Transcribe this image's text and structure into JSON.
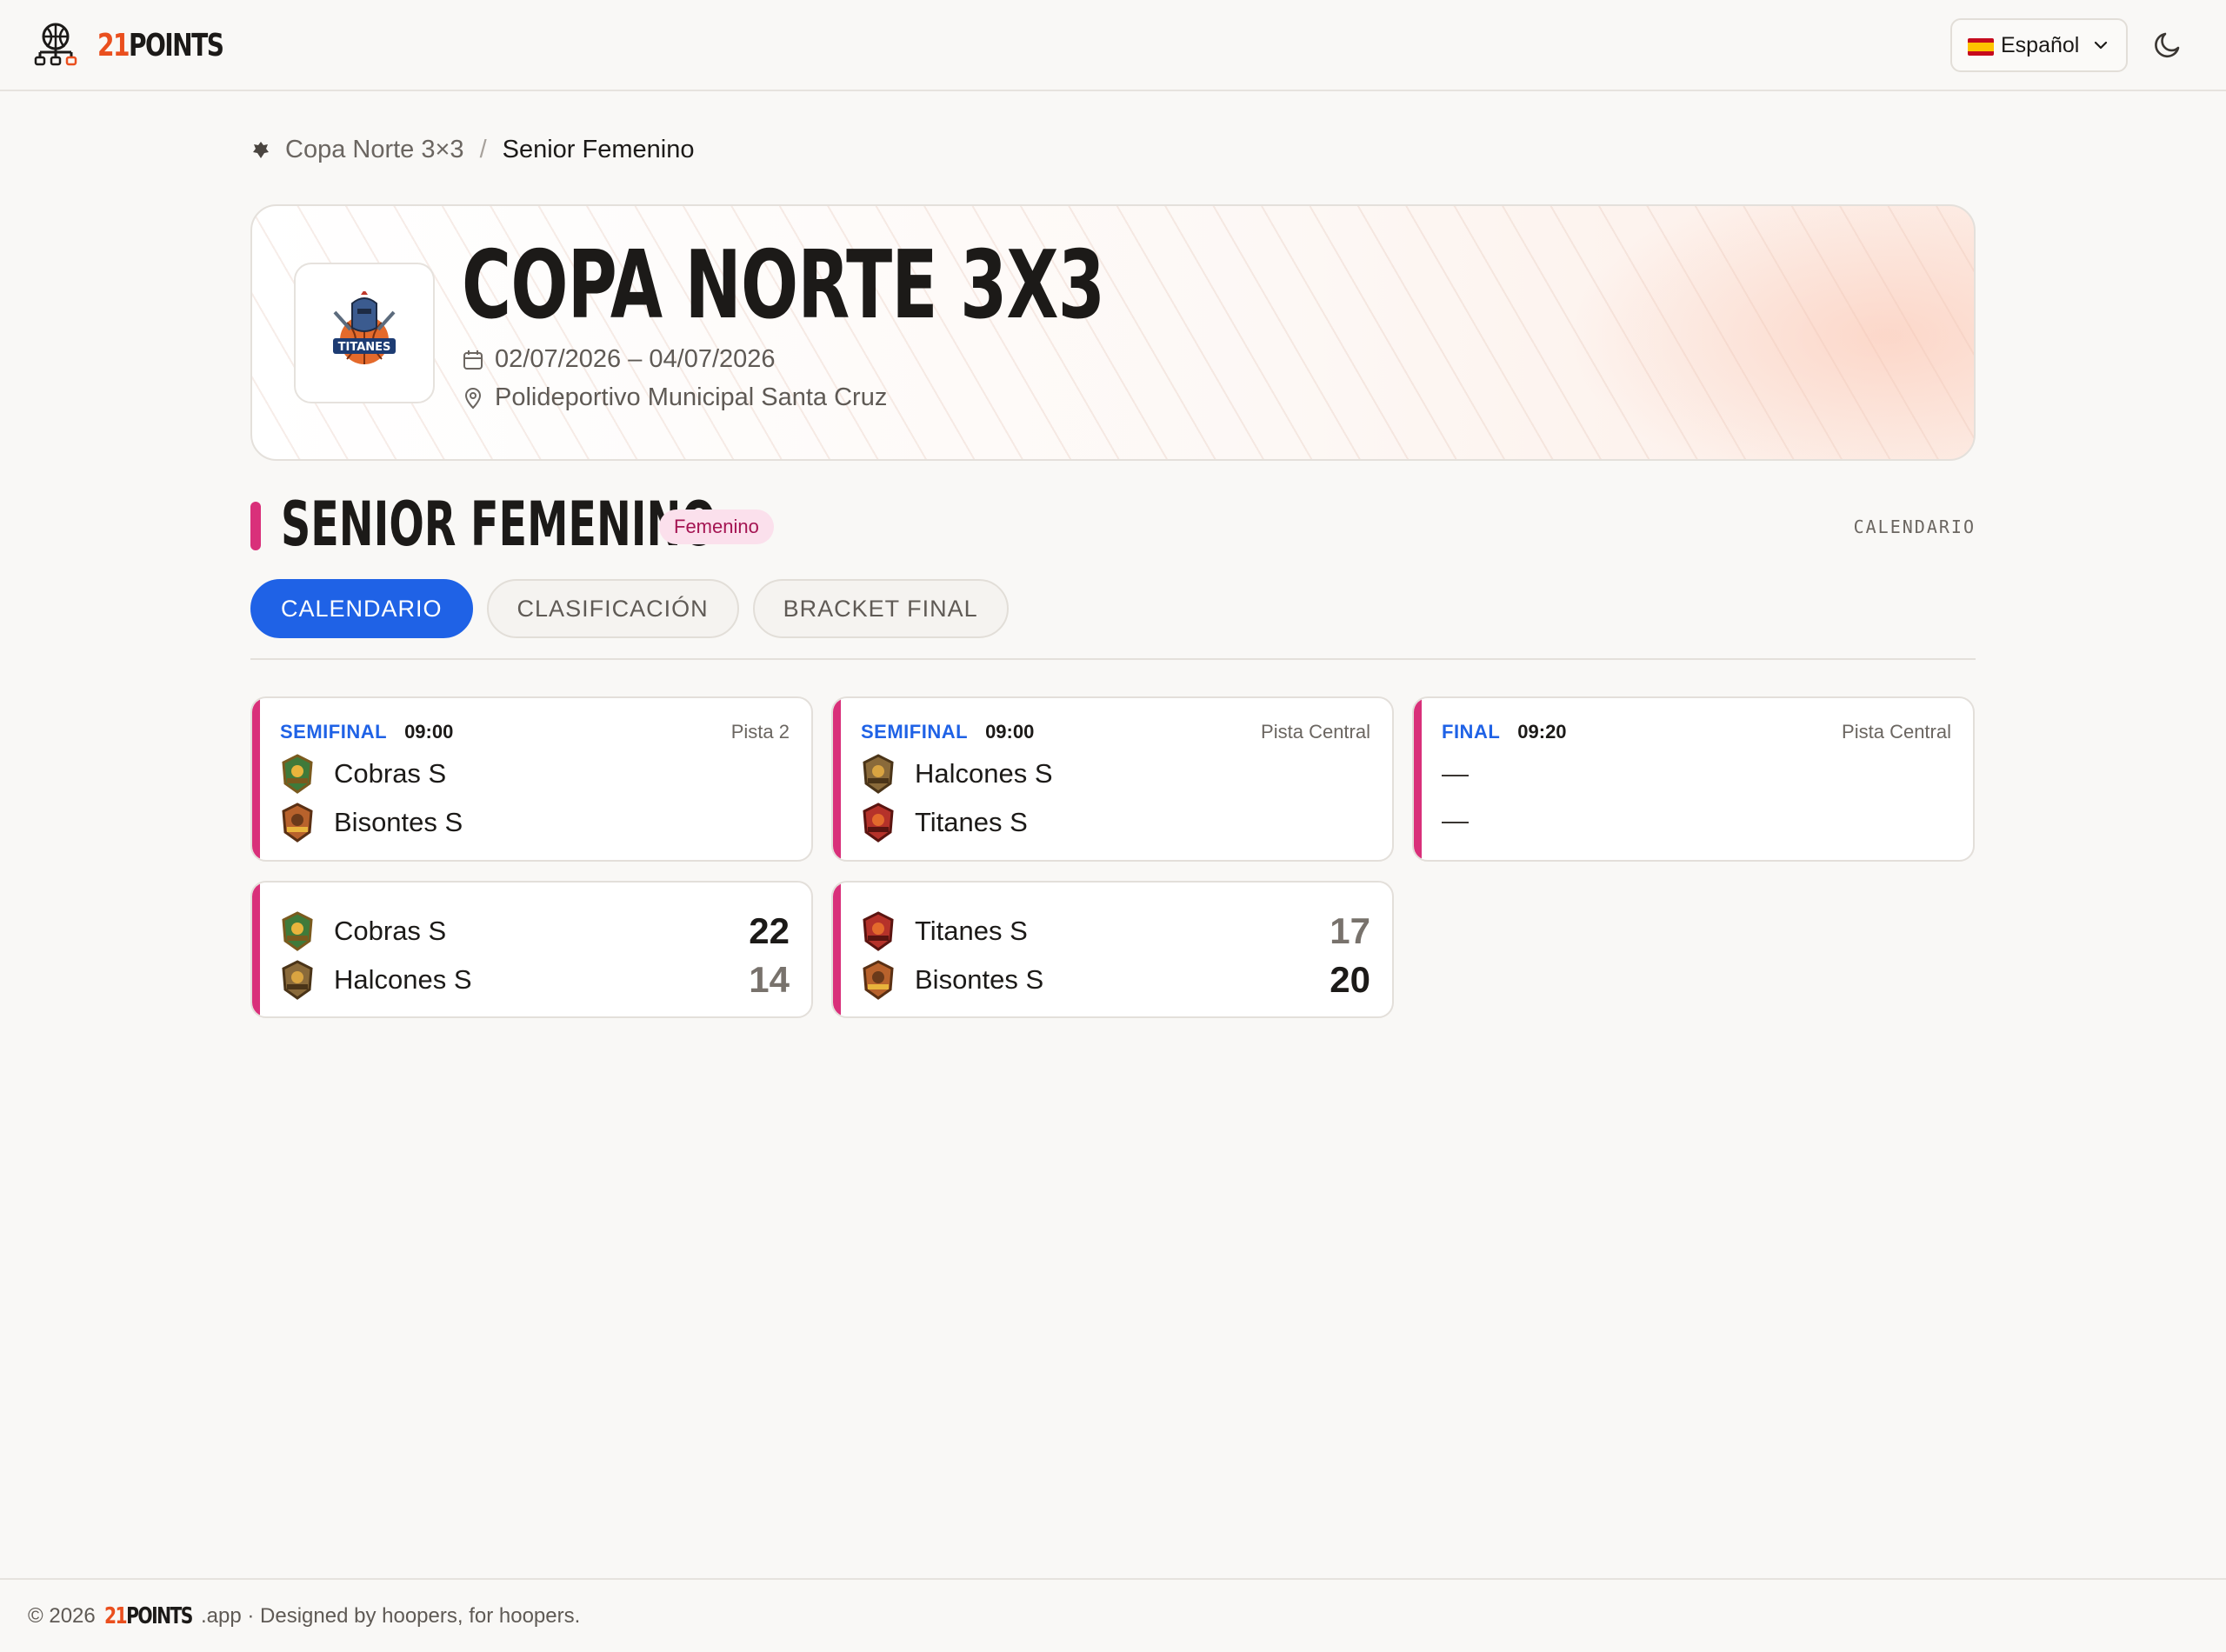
{
  "header": {
    "logo": {
      "num": "21",
      "word": "POINTS"
    },
    "language": {
      "flag": "es-flag",
      "label": "Español"
    },
    "theme_icon": "moon-icon"
  },
  "breadcrumb": {
    "tournament": "Copa Norte 3×3",
    "separator": "/",
    "category": "Senior Femenino"
  },
  "hero": {
    "title": "COPA NORTE 3X3",
    "dates": "02/07/2026 – 04/07/2026",
    "venue": "Polideportivo Municipal Santa Cruz",
    "logo_text": "TITANES"
  },
  "section": {
    "title": "SENIOR FEMENINO",
    "badge": "Femenino",
    "right_label": "CALENDARIO"
  },
  "tabs": [
    {
      "label": "CALENDARIO",
      "active": true
    },
    {
      "label": "CLASIFICACIÓN",
      "active": false
    },
    {
      "label": "BRACKET FINAL",
      "active": false
    }
  ],
  "matches": [
    {
      "round": "SEMIFINAL",
      "time": "09:00",
      "court": "Pista 2",
      "home": "Cobras S",
      "away": "Bisontes S"
    },
    {
      "round": "SEMIFINAL",
      "time": "09:00",
      "court": "Pista Central",
      "home": "Halcones S",
      "away": "Titanes S"
    },
    {
      "round": "FINAL",
      "time": "09:20",
      "court": "Pista Central",
      "home": "—",
      "away": "—"
    },
    {
      "home": "Cobras S",
      "home_score": "22",
      "away": "Halcones S",
      "away_score": "14"
    },
    {
      "home": "Titanes S",
      "home_score": "17",
      "away": "Bisontes S",
      "away_score": "20"
    }
  ],
  "footer": {
    "copyright": "© 2026",
    "logo_num": "21",
    "logo_word": "POINTS",
    "suffix": ".app · Designed by hoopers, for hoopers."
  },
  "colors": {
    "accent_blue": "#1f62e6",
    "category_pink": "#d9307a",
    "brand_orange": "#ea4f1e"
  }
}
